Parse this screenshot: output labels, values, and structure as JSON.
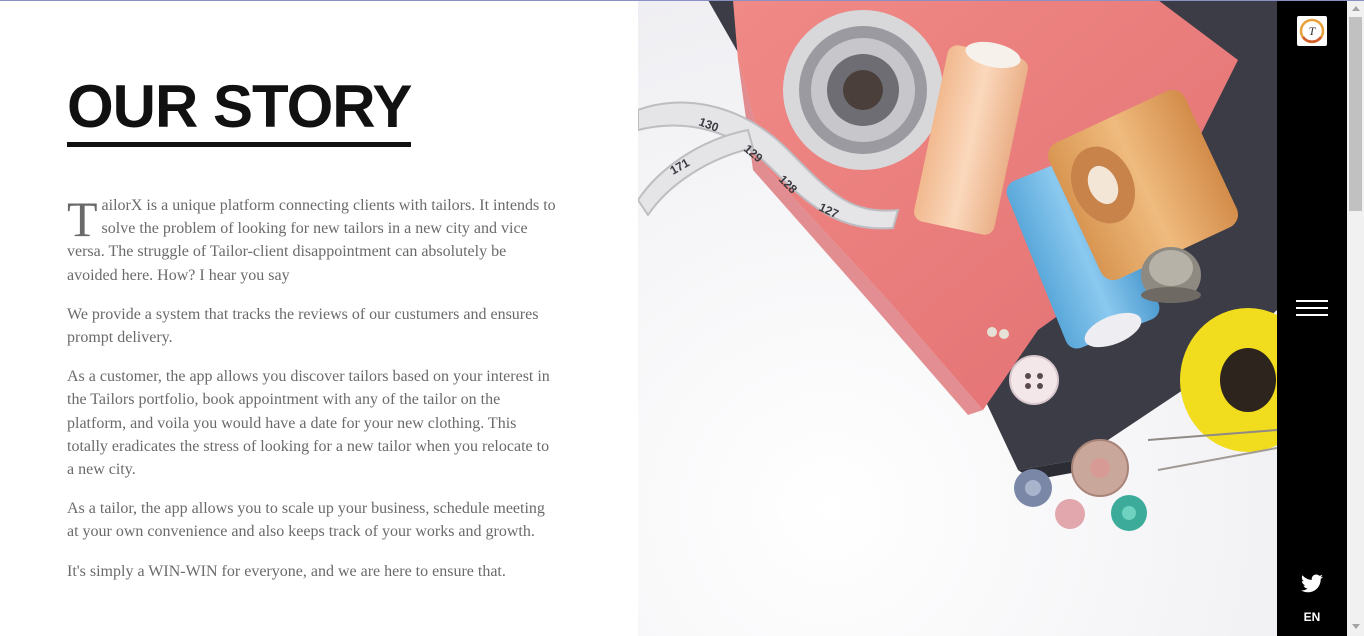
{
  "page": {
    "title": "OUR STORY"
  },
  "story": {
    "dropcap": "T",
    "paragraph1_rest": "ailorX is a unique platform connecting clients with tailors. It intends to solve the problem of looking for new tailors in a new city and vice versa. The struggle of Tailor-client disappointment can absolutely be avoided here. How? I hear you say",
    "paragraph2": "We provide a system that tracks the reviews of our custumers and ensures prompt delivery.",
    "paragraph3": "As a customer, the app allows you discover tailors based on your interest in the Tailors portfolio, book appointment with any of the tailor on the platform, and voila you would have a date for your new clothing. This totally eradicates the stress of looking for a new tailor when you relocate to a new city.",
    "paragraph4": "As a tailor, the app allows you to scale up your business, schedule meeting at your own convenience and also keeps track of your works and growth.",
    "paragraph5": "It's simply a WIN-WIN for everyone, and we are here to ensure that."
  },
  "sidebar": {
    "logo_icon": "tailorx-logo-icon",
    "menu_icon": "hamburger-menu-icon",
    "social_icon": "twitter-icon",
    "language": "EN"
  },
  "colors": {
    "sidebar_bg": "#000000",
    "title_color": "#111111",
    "body_text": "#6a6a6a",
    "fabric_pink": "#ec7b7b",
    "fabric_dark": "#3d3e47",
    "thread_blue": "#6ab5e2",
    "thread_peach": "#f4c9a5",
    "thread_orange": "#e6a865",
    "thread_yellow": "#f4df2a"
  }
}
